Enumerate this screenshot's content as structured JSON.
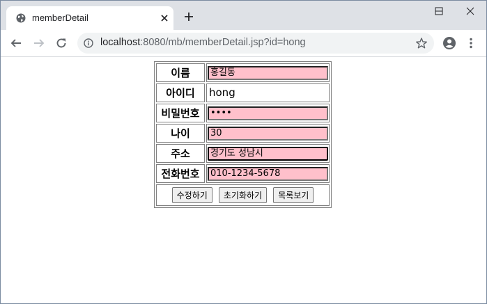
{
  "browser": {
    "tab_title": "memberDetail",
    "url_host": "localhost",
    "url_rest": ":8080/mb/memberDetail.jsp?id=hong",
    "icons": {
      "favicon": "globe-icon",
      "tab_close": "close-icon",
      "new_tab": "plus-icon",
      "back": "arrow-left-icon",
      "forward": "arrow-right-icon",
      "reload": "reload-icon",
      "site_info": "info-icon",
      "bookmark": "star-icon",
      "profile": "account-icon",
      "menu": "more-vert-icon"
    }
  },
  "form": {
    "rows": [
      {
        "label": "이름",
        "value": "홍길동"
      },
      {
        "label": "아이디",
        "value": "hong"
      },
      {
        "label": "비밀번호",
        "value": "••••"
      },
      {
        "label": "나이",
        "value": "30"
      },
      {
        "label": "주소",
        "value": "경기도 성남시"
      },
      {
        "label": "전화번호",
        "value": "010-1234-5678"
      }
    ],
    "buttons": {
      "update": "수정하기",
      "reset": "초기화하기",
      "list": "목록보기"
    }
  }
}
